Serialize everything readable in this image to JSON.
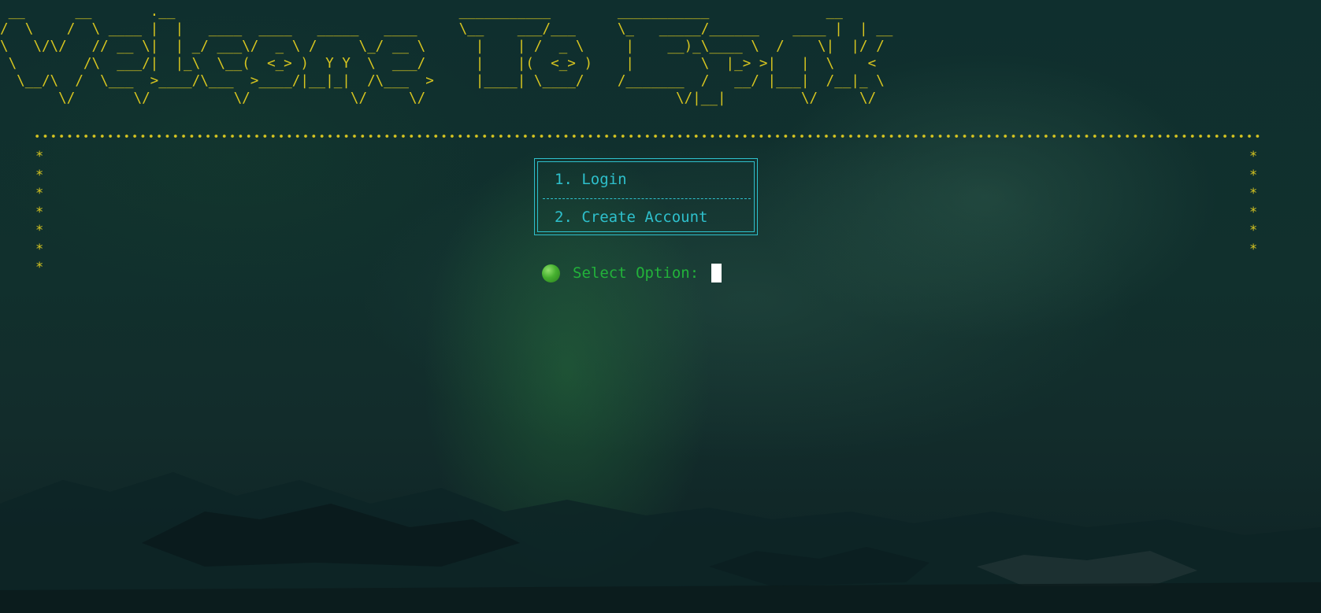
{
  "banner": {
    "ascii": " __      __       .__                                  ___________        ___________              __    \n/  \\    /  \\ ____ |  |   ____  ____   _____   ____     \\__    ___/___     \\_   _____/______    ____ |  | __\n\\   \\/\\/   // __ \\|  | _/ ___\\/  _ \\ /     \\_/ __ \\      |    | /  _ \\     |    __)_\\____ \\  /    \\|  |/ /\n \\        /\\  ___/|  |_\\  \\__(  <_> )  Y Y  \\  ___/      |    |(  <_> )    |        \\  |_> >|   |  \\    < \n  \\__/\\  /  \\___  >____/\\___  >____/|__|_|  /\\___  >     |____| \\____/    /_______  /   __/ |___|  /__|_ \\\n       \\/       \\/          \\/            \\/     \\/                              \\/|__|         \\/     \\/"
  },
  "border": {
    "left_stars": "*\n*\n*\n*\n*\n*\n*",
    "right_stars": "*\n*\n*\n*\n*\n*"
  },
  "menu": {
    "items": [
      {
        "label": "1. Login"
      },
      {
        "label": "2. Create Account"
      }
    ]
  },
  "prompt": {
    "icon": "green-circle-icon",
    "label": "Select Option:",
    "value": ""
  },
  "colors": {
    "banner": "#d7c520",
    "menu": "#2ec0cc",
    "prompt": "#22b23a",
    "background": "#11302d"
  }
}
